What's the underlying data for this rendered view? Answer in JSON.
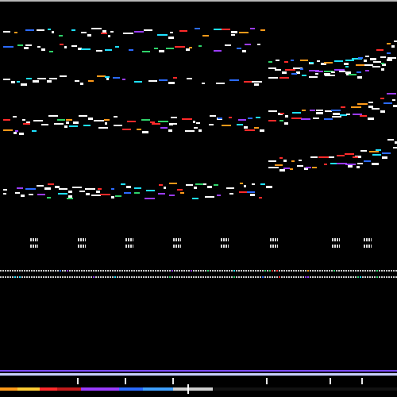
{
  "app": {
    "title": ""
  },
  "view": {
    "background": "#000000",
    "palette": {
      "white": "#ffffff",
      "green": "#2fd36a",
      "purple": "#9b3cff",
      "blue": "#2b6bff",
      "orange": "#ff9a1a",
      "red": "#ff2a2a",
      "cyan": "#1ee0ff"
    }
  },
  "timeline": {
    "segment_colors": [
      "#ff9a1a",
      "#ffcc33",
      "#ff2a2a",
      "#c21b1b",
      "#9b3cff",
      "#2b6bff",
      "#3fa0ff",
      "#cfcfcf"
    ]
  }
}
